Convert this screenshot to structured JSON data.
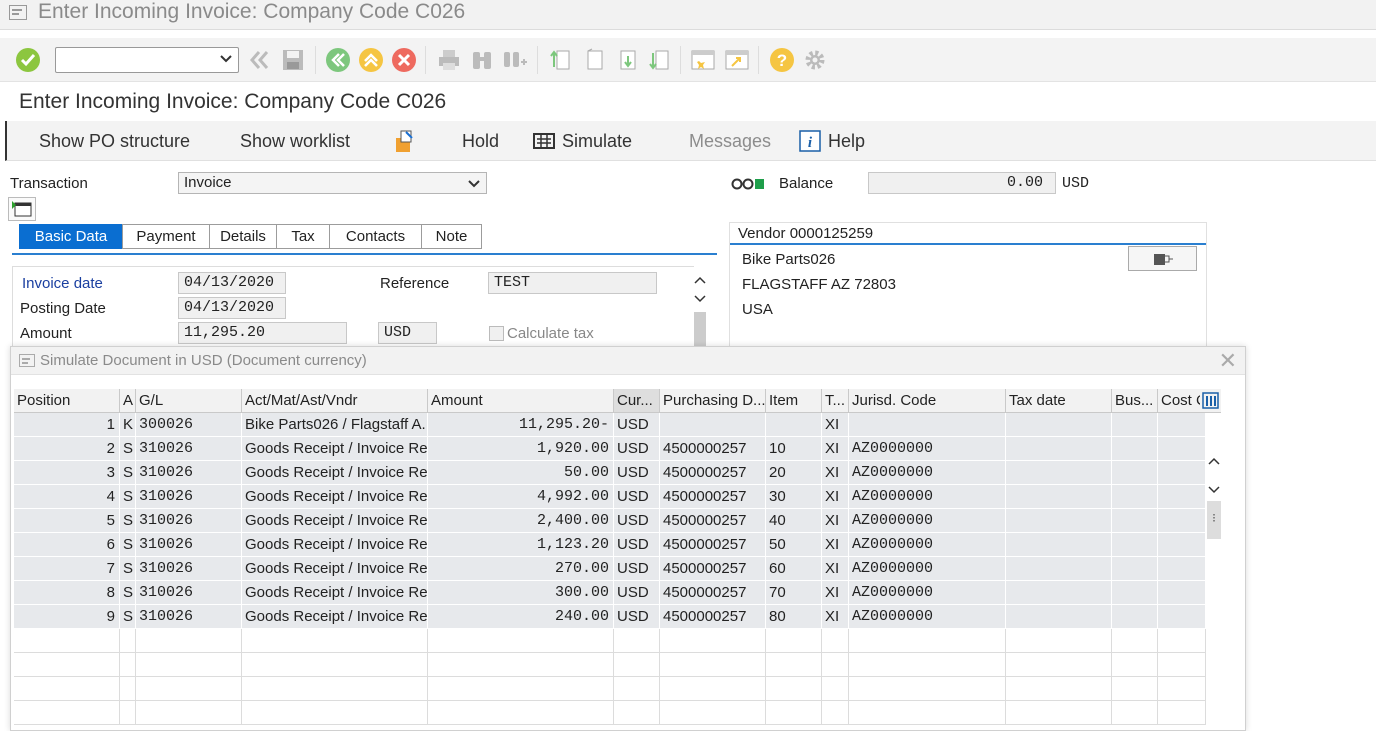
{
  "window": {
    "title": "Enter Incoming Invoice: Company Code C026"
  },
  "page": {
    "title": "Enter Incoming Invoice: Company Code C026"
  },
  "app_toolbar": {
    "show_po_structure": "Show PO structure",
    "show_worklist": "Show worklist",
    "hold": "Hold",
    "simulate": "Simulate",
    "messages": "Messages",
    "help": "Help"
  },
  "header": {
    "transaction_label": "Transaction",
    "transaction_value": "Invoice",
    "balance_label": "Balance",
    "balance_value": "0.00",
    "balance_currency": "USD"
  },
  "tabs": [
    "Basic Data",
    "Payment",
    "Details",
    "Tax",
    "Contacts",
    "Note"
  ],
  "basic_data": {
    "invoice_date_label": "Invoice date",
    "invoice_date": "04/13/2020",
    "posting_date_label": "Posting Date",
    "posting_date": "04/13/2020",
    "amount_label": "Amount",
    "amount": "11,295.20",
    "currency": "USD",
    "reference_label": "Reference",
    "reference": "TEST",
    "calculate_tax_label": "Calculate tax"
  },
  "vendor": {
    "title": "Vendor 0000125259",
    "line1": "Bike Parts026",
    "line2": "FLAGSTAFF AZ  72803",
    "line3": "USA"
  },
  "popup": {
    "title": "Simulate Document in USD (Document currency)",
    "columns": [
      "Position",
      "A",
      "G/L",
      "Act/Mat/Ast/Vndr",
      "Amount",
      "Cur...",
      "Purchasing D...",
      "Item",
      "T...",
      "Jurisd. Code",
      "Tax date",
      "Bus...",
      "Cost C"
    ],
    "rows": [
      [
        "1",
        "K",
        "300026",
        "Bike Parts026 / Flagstaff A...",
        "11,295.20-",
        "USD",
        "",
        "",
        "XI",
        "",
        "",
        "",
        ""
      ],
      [
        "2",
        "S",
        "310026",
        "Goods Receipt / Invoice Re...",
        "1,920.00",
        "USD",
        "4500000257",
        "10",
        "XI",
        "AZ0000000",
        "",
        "",
        ""
      ],
      [
        "3",
        "S",
        "310026",
        "Goods Receipt / Invoice Re...",
        "50.00",
        "USD",
        "4500000257",
        "20",
        "XI",
        "AZ0000000",
        "",
        "",
        ""
      ],
      [
        "4",
        "S",
        "310026",
        "Goods Receipt / Invoice Re...",
        "4,992.00",
        "USD",
        "4500000257",
        "30",
        "XI",
        "AZ0000000",
        "",
        "",
        ""
      ],
      [
        "5",
        "S",
        "310026",
        "Goods Receipt / Invoice Re...",
        "2,400.00",
        "USD",
        "4500000257",
        "40",
        "XI",
        "AZ0000000",
        "",
        "",
        ""
      ],
      [
        "6",
        "S",
        "310026",
        "Goods Receipt / Invoice Re...",
        "1,123.20",
        "USD",
        "4500000257",
        "50",
        "XI",
        "AZ0000000",
        "",
        "",
        ""
      ],
      [
        "7",
        "S",
        "310026",
        "Goods Receipt / Invoice Re...",
        "270.00",
        "USD",
        "4500000257",
        "60",
        "XI",
        "AZ0000000",
        "",
        "",
        ""
      ],
      [
        "8",
        "S",
        "310026",
        "Goods Receipt / Invoice Re...",
        "300.00",
        "USD",
        "4500000257",
        "70",
        "XI",
        "AZ0000000",
        "",
        "",
        ""
      ],
      [
        "9",
        "S",
        "310026",
        "Goods Receipt / Invoice Re...",
        "240.00",
        "USD",
        "4500000257",
        "80",
        "XI",
        "AZ0000000",
        "",
        "",
        ""
      ]
    ]
  },
  "colors": {
    "accent": "#0a6ed1",
    "ok_green": "#8cc63f",
    "cancel_red": "#e74c3c",
    "nav_green": "#66bb6a",
    "help_yellow": "#f5c542"
  }
}
